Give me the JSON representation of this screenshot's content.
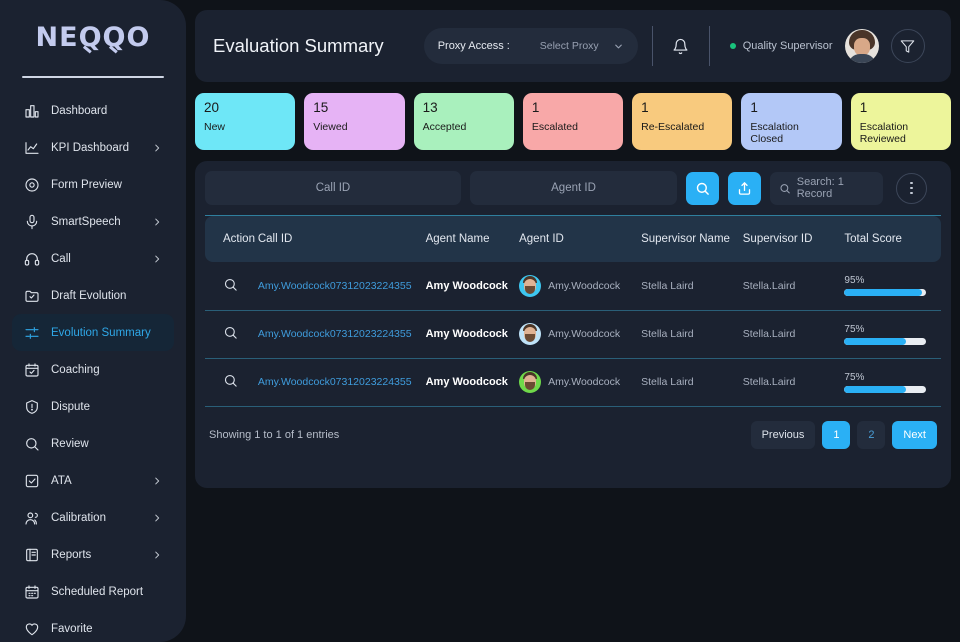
{
  "brand": {
    "name": "NEQQO"
  },
  "sidebar": {
    "items": [
      {
        "label": "Dashboard",
        "icon": "chart-bar-icon",
        "chevron": false,
        "active": false
      },
      {
        "label": "KPI Dashboard",
        "icon": "line-chart-icon",
        "chevron": true,
        "active": false
      },
      {
        "label": "Form Preview",
        "icon": "target-circle-icon",
        "chevron": false,
        "active": false
      },
      {
        "label": "SmartSpeech",
        "icon": "microphone-icon",
        "chevron": true,
        "active": false
      },
      {
        "label": "Call",
        "icon": "headset-icon",
        "chevron": true,
        "active": false
      },
      {
        "label": "Draft Evolution",
        "icon": "folder-check-icon",
        "chevron": false,
        "active": false
      },
      {
        "label": "Evolution Summary",
        "icon": "sliders-icon",
        "chevron": false,
        "active": true
      },
      {
        "label": "Coaching",
        "icon": "calendar-check-icon",
        "chevron": false,
        "active": false
      },
      {
        "label": "Dispute",
        "icon": "shield-alert-icon",
        "chevron": false,
        "active": false
      },
      {
        "label": "Review",
        "icon": "search-icon",
        "chevron": false,
        "active": false
      },
      {
        "label": "ATA",
        "icon": "checkbox-icon",
        "chevron": true,
        "active": false
      },
      {
        "label": "Calibration",
        "icon": "users-icon",
        "chevron": true,
        "active": false
      },
      {
        "label": "Reports",
        "icon": "book-icon",
        "chevron": true,
        "active": false
      },
      {
        "label": "Scheduled Report",
        "icon": "calendar-icon",
        "chevron": false,
        "active": false
      },
      {
        "label": "Favorite",
        "icon": "heart-icon",
        "chevron": false,
        "active": false
      }
    ]
  },
  "header": {
    "title": "Evaluation Summary",
    "proxy_label": "Proxy Access :",
    "proxy_value": "Select Proxy",
    "role": "Quality Supervisor",
    "bell_icon": "bell-icon",
    "filter_icon": "funnel-icon",
    "avatar_icon": "user-avatar"
  },
  "stats": [
    {
      "count": "20",
      "label": "New",
      "color": "#6ee7f7"
    },
    {
      "count": "15",
      "label": "Viewed",
      "color": "#e6b3f5"
    },
    {
      "count": "13",
      "label": "Accepted",
      "color": "#a9f0bd"
    },
    {
      "count": "1",
      "label": "Escalated",
      "color": "#f8a8a8"
    },
    {
      "count": "1",
      "label": "Re-Escalated",
      "color": "#f8ca7e"
    },
    {
      "count": "1",
      "label": "Escalation Closed",
      "color": "#b3c8f7"
    },
    {
      "count": "1",
      "label": "Escalation Reviewed",
      "color": "#edf59b"
    }
  ],
  "toolbar": {
    "call_id_placeholder": "Call ID",
    "agent_id_placeholder": "Agent ID",
    "search_button_icon": "search-icon",
    "export_button_icon": "upload-share-icon",
    "search_record_label": "Search: 1 Record",
    "search_record_icon": "search-icon",
    "more_icon": "kebab-menu-icon"
  },
  "table": {
    "columns": [
      "Action",
      "Call ID",
      "Agent Name",
      "Agent ID",
      "Supervisor Name",
      "Supervisor ID",
      "Total Score"
    ],
    "rows": [
      {
        "action_icon": "magnifier-icon",
        "call_id": "Amy.Woodcock07312023224355",
        "agent_name": "Amy Woodcock",
        "agent_id": "Amy.Woodcock",
        "avatar_color": "#3ec7f0",
        "supervisor_name": "Stella Laird",
        "supervisor_id": "Stella.Laird",
        "score": "95%",
        "score_value": 95
      },
      {
        "action_icon": "magnifier-icon",
        "call_id": "Amy.Woodcock07312023224355",
        "agent_name": "Amy Woodcock",
        "agent_id": "Amy.Woodcock",
        "avatar_color": "#bfe2f7",
        "supervisor_name": "Stella Laird",
        "supervisor_id": "Stella.Laird",
        "score": "75%",
        "score_value": 75
      },
      {
        "action_icon": "magnifier-icon",
        "call_id": "Amy.Woodcock07312023224355",
        "agent_name": "Amy Woodcock",
        "agent_id": "Amy.Woodcock",
        "avatar_color": "#6fd94a",
        "supervisor_name": "Stella Laird",
        "supervisor_id": "Stella.Laird",
        "score": "75%",
        "score_value": 75
      }
    ]
  },
  "pagination": {
    "info": "Showing 1 to 1 of 1 entries",
    "previous": "Previous",
    "pages": [
      "1",
      "2"
    ],
    "current_page": "1",
    "next": "Next"
  },
  "colors": {
    "accent": "#2ab0f5",
    "sidebar_bg": "#1b2230",
    "page_bg": "#0f1319",
    "link": "#3f9cdc",
    "divider": "#2a5f78",
    "status_dot": "#19c37d"
  }
}
